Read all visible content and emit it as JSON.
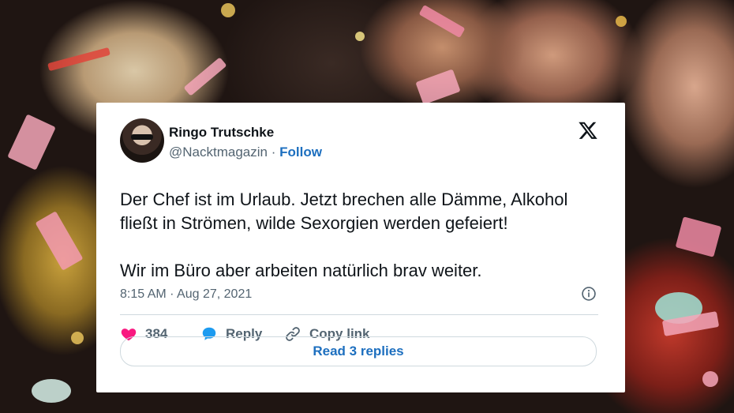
{
  "tweet": {
    "author_name": "Ringo Trutschke",
    "handle": "@Nacktmagazin",
    "separator": "·",
    "follow_label": "Follow",
    "text_line_1": "Der Chef ist im Urlaub. Jetzt brechen alle Dämme, Alkohol fließt in Strömen, wilde Sexorgien werden gefeiert!",
    "text_line_2": "Wir im Büro aber arbeiten natürlich brav weiter.",
    "timestamp": "8:15 AM · Aug 27, 2021",
    "likes": "384",
    "reply_label": "Reply",
    "copy_link_label": "Copy link",
    "read_replies_label": "Read 3 replies"
  },
  "icons": {
    "brand": "x-logo-icon",
    "info": "info-icon",
    "like": "heart-icon",
    "reply": "speech-bubble-icon",
    "copy": "link-icon"
  },
  "colors": {
    "link_blue": "#1d6fbf",
    "heart": "#f91880",
    "reply_bubble": "#1d9bf0",
    "text": "#0f1419",
    "muted": "#536471"
  }
}
